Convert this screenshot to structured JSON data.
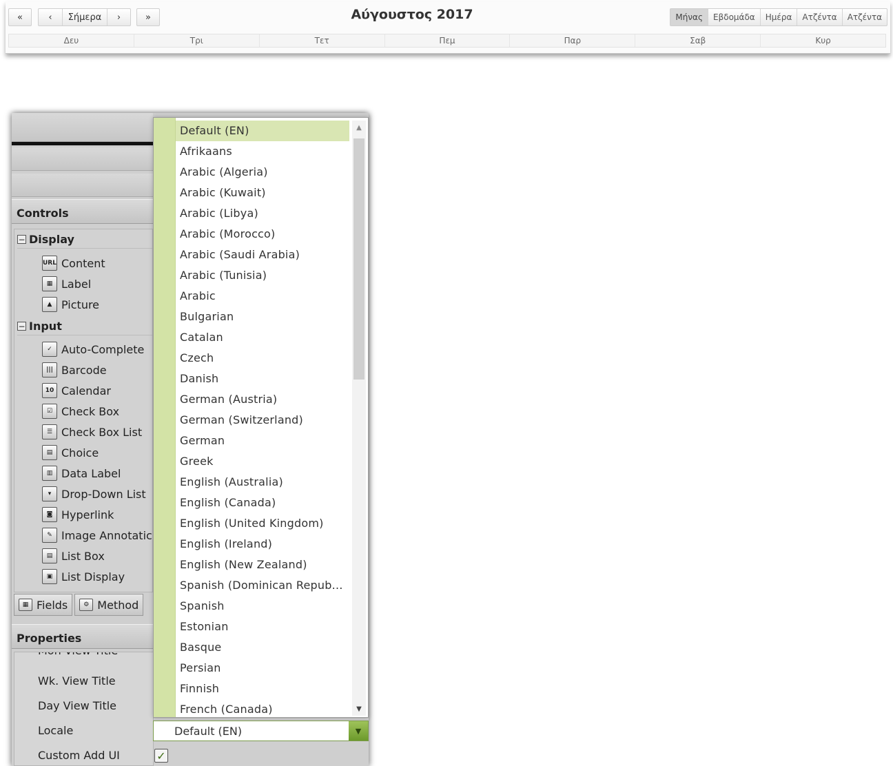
{
  "calendar": {
    "nav": {
      "first": "«",
      "prev": "‹",
      "today": "Σήμερα",
      "next": "›",
      "last": "»"
    },
    "title": "Αύγουστος 2017",
    "views": [
      "Μήνας",
      "Εβδομάδα",
      "Ημέρα",
      "Ατζέντα",
      "Ατζέντα"
    ],
    "active_view": "Μήνας",
    "weekdays": [
      "Δευ",
      "Τρι",
      "Τετ",
      "Πεμ",
      "Παρ",
      "Σαβ",
      "Κυρ"
    ]
  },
  "designer": {
    "controls_title": "Controls",
    "groups": {
      "display": {
        "label": "Display",
        "items": [
          "Content",
          "Label",
          "Picture"
        ]
      },
      "input": {
        "label": "Input",
        "items": [
          "Auto-Complete",
          "Barcode",
          "Calendar",
          "Check Box",
          "Check Box List",
          "Choice",
          "Data Label",
          "Drop-Down List",
          "Hyperlink",
          "Image Annotatic",
          "List Box",
          "List Display"
        ]
      }
    },
    "tabs": [
      "Fields",
      "Method"
    ],
    "properties_title": "Properties",
    "properties": {
      "partial_row": "Mon View Title",
      "rows": [
        "Wk. View Title",
        "Day View Title",
        "Locale",
        "Custom Add UI"
      ]
    },
    "locale_value": "Default (EN)",
    "custom_add_ui_checked": true
  },
  "locale_dropdown": {
    "selected": "Default (EN)",
    "options": [
      "Default (EN)",
      "Afrikaans",
      "Arabic (Algeria)",
      "Arabic (Kuwait)",
      "Arabic (Libya)",
      "Arabic (Morocco)",
      "Arabic (Saudi Arabia)",
      "Arabic (Tunisia)",
      "Arabic",
      "Bulgarian",
      "Catalan",
      "Czech",
      "Danish",
      "German (Austria)",
      "German (Switzerland)",
      "German",
      "Greek",
      "English (Australia)",
      "English (Canada)",
      "English (United Kingdom)",
      "English (Ireland)",
      "English (New Zealand)",
      "Spanish (Dominican Repub…",
      "Spanish",
      "Estonian",
      "Basque",
      "Persian",
      "Finnish",
      "French (Canada)"
    ]
  },
  "icons": {
    "Content": "url-icon",
    "Label": "label-icon",
    "Picture": "picture-icon",
    "Auto-Complete": "auto-complete-icon",
    "Barcode": "barcode-icon",
    "Calendar": "calendar-icon",
    "Check Box": "check-box-icon",
    "Check Box List": "check-box-list-icon",
    "Choice": "choice-icon",
    "Data Label": "data-label-icon",
    "Drop-Down List": "drop-down-list-icon",
    "Hyperlink": "hyperlink-icon",
    "Image Annotatic": "image-annotation-icon",
    "List Box": "list-box-icon",
    "List Display": "list-display-icon"
  }
}
